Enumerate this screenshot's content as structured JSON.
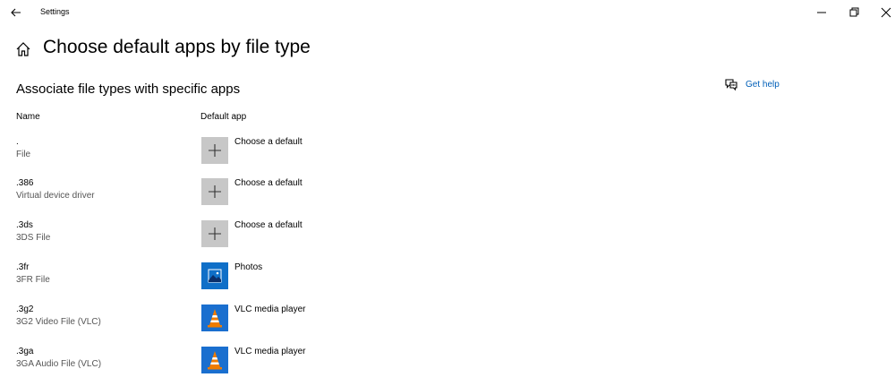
{
  "window": {
    "title": "Settings",
    "controls": [
      "minimize",
      "restore",
      "close"
    ]
  },
  "page": {
    "title": "Choose default apps by file type",
    "section_title": "Associate file types with specific apps"
  },
  "help": {
    "label": "Get help"
  },
  "columns": {
    "name": "Name",
    "default_app": "Default app"
  },
  "rows": [
    {
      "extension": ".",
      "description": "File",
      "app": "Choose a default",
      "app_icon": "plus-icon"
    },
    {
      "extension": ".386",
      "description": "Virtual device driver",
      "app": "Choose a default",
      "app_icon": "plus-icon"
    },
    {
      "extension": ".3ds",
      "description": "3DS File",
      "app": "Choose a default",
      "app_icon": "plus-icon"
    },
    {
      "extension": ".3fr",
      "description": "3FR File",
      "app": "Photos",
      "app_icon": "photos-icon"
    },
    {
      "extension": ".3g2",
      "description": "3G2 Video File (VLC)",
      "app": "VLC media player",
      "app_icon": "vlc-icon"
    },
    {
      "extension": ".3ga",
      "description": "3GA Audio File (VLC)",
      "app": "VLC media player",
      "app_icon": "vlc-icon"
    }
  ],
  "colors": {
    "accent_link": "#005fb8",
    "plus_tile": "#c7c7c7",
    "photos_tile": "#0f6fc8",
    "vlc_tile": "#1a6fcf",
    "vlc_cone": "#f07c00"
  }
}
